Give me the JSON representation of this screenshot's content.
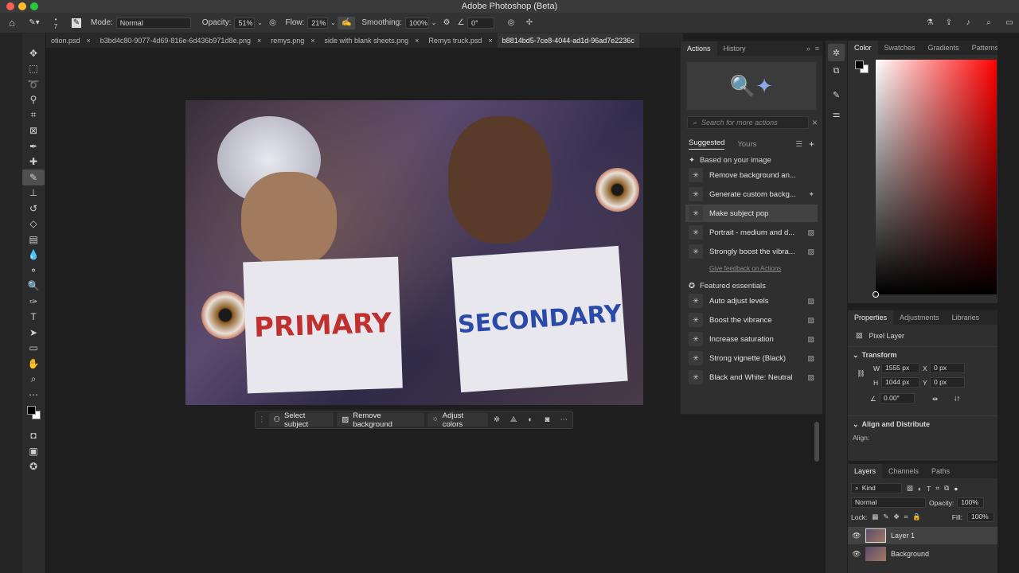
{
  "app": {
    "title": "Adobe Photoshop (Beta)"
  },
  "options_bar": {
    "mode_label": "Mode:",
    "mode_value": "Normal",
    "opacity_label": "Opacity:",
    "opacity_value": "51%",
    "flow_label": "Flow:",
    "flow_value": "21%",
    "smoothing_label": "Smoothing:",
    "smoothing_value": "100%",
    "angle_value": "0°",
    "brush_size": "7"
  },
  "tabs": [
    {
      "label": "otion.psd"
    },
    {
      "label": "b3bd4c80-9077-4d69-816e-6d436b971d8e.png"
    },
    {
      "label": "remys.png"
    },
    {
      "label": "side with blank sheets.png"
    },
    {
      "label": "Remys truck.psd"
    },
    {
      "label": "b8814bd5-7ce8-4044-ad1d-96ad7e2236c"
    }
  ],
  "canvas": {
    "sign_left": "PRIMARY",
    "sign_right": "SECONDARY"
  },
  "contextual_bar": {
    "select_subject": "Select subject",
    "remove_background": "Remove background",
    "adjust_colors": "Adjust colors"
  },
  "actions_panel": {
    "tab_actions": "Actions",
    "tab_history": "History",
    "search_placeholder": "Search for more actions",
    "sub_suggested": "Suggested",
    "sub_yours": "Yours",
    "based_on": "Based on your image",
    "suggested": [
      {
        "label": "Remove background an..."
      },
      {
        "label": "Generate custom backg..."
      },
      {
        "label": "Make subject pop"
      },
      {
        "label": "Portrait - medium and d..."
      },
      {
        "label": "Strongly boost the vibra..."
      }
    ],
    "feedback_link": "Give feedback on Actions",
    "featured_title": "Featured essentials",
    "featured": [
      {
        "label": "Auto adjust levels"
      },
      {
        "label": "Boost the vibrance"
      },
      {
        "label": "Increase saturation"
      },
      {
        "label": "Strong vignette (Black)"
      },
      {
        "label": "Black and White: Neutral"
      }
    ]
  },
  "color_panel": {
    "tabs": [
      "Color",
      "Swatches",
      "Gradients",
      "Patterns"
    ]
  },
  "properties": {
    "tabs": [
      "Properties",
      "Adjustments",
      "Libraries"
    ],
    "layer_type": "Pixel Layer",
    "transform_title": "Transform",
    "w_label": "W",
    "w_value": "1555 px",
    "h_label": "H",
    "h_value": "1044 px",
    "x_label": "X",
    "x_value": "0 px",
    "y_label": "Y",
    "y_value": "0 px",
    "angle_value": "0.00°",
    "align_title": "Align and Distribute",
    "align_label": "Align:"
  },
  "layers": {
    "tabs": [
      "Layers",
      "Channels",
      "Paths"
    ],
    "kind_label": "Kind",
    "blend_mode": "Normal",
    "opacity_label": "Opacity:",
    "opacity_value": "100%",
    "lock_label": "Lock:",
    "fill_label": "Fill:",
    "fill_value": "100%",
    "items": [
      {
        "name": "Layer 1"
      },
      {
        "name": "Background"
      }
    ]
  },
  "colors": {
    "accent": "#4a8ad9",
    "primary_red": "#c0302f",
    "secondary_blue": "#2a4aa8"
  }
}
